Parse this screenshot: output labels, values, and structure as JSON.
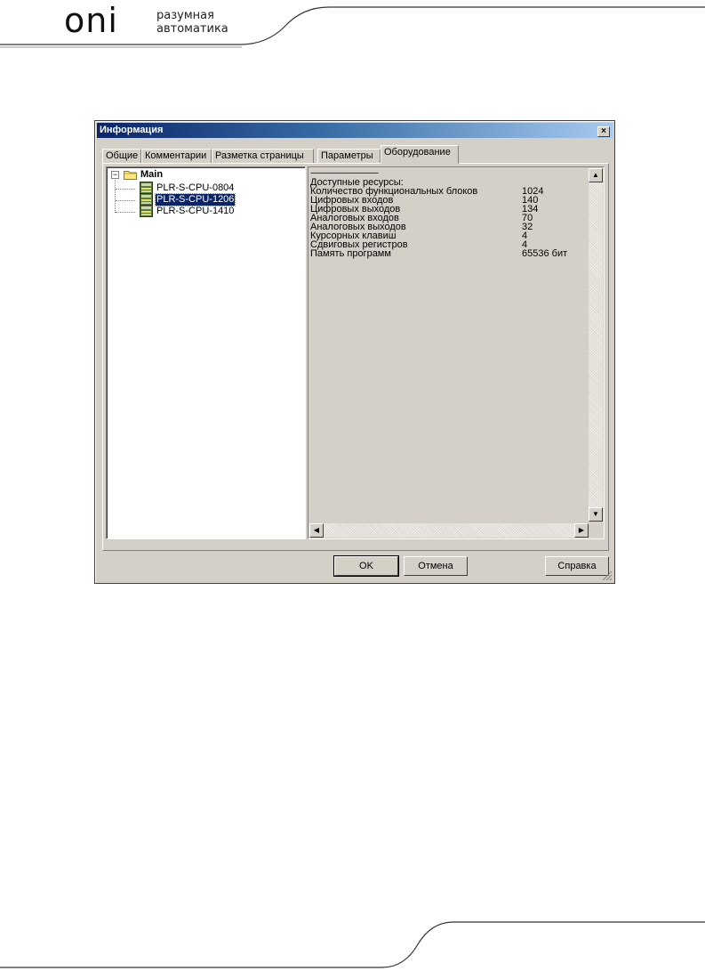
{
  "brand": {
    "logo": "oni",
    "tagline_line1": "разумная",
    "tagline_line2": "автоматика"
  },
  "dialog": {
    "title": "Информация",
    "close_glyph": "×",
    "tabs": [
      {
        "label": "Общие",
        "active": false
      },
      {
        "label": "Комментарии",
        "active": false
      },
      {
        "label": "Разметка страницы",
        "active": false
      },
      {
        "label": "Параметры",
        "active": false
      },
      {
        "label": "Оборудование",
        "active": true
      }
    ],
    "tree": {
      "root": {
        "label": "Main",
        "expander": "−",
        "icon": "folder-icon"
      },
      "children": [
        {
          "label": "PLR-S-CPU-0804",
          "selected": false,
          "icon": "cpu-module-icon"
        },
        {
          "label": "PLR-S-CPU-1206",
          "selected": true,
          "icon": "cpu-module-icon"
        },
        {
          "label": "PLR-S-CPU-1410",
          "selected": false,
          "icon": "cpu-module-icon"
        }
      ]
    },
    "info": {
      "separator": "--------------------------------------",
      "heading": "Доступные ресурсы:",
      "rows": [
        {
          "key": "Количество функциональных блоков",
          "value": "1024"
        },
        {
          "key": "Цифровых входов",
          "value": "140"
        },
        {
          "key": "Цифровых выходов",
          "value": "134"
        },
        {
          "key": "Аналоговых входов",
          "value": "70"
        },
        {
          "key": "Аналоговых выходов",
          "value": "32"
        },
        {
          "key": "Курсорных клавиш",
          "value": "4"
        },
        {
          "key": "Сдвиговых регистров",
          "value": "4"
        },
        {
          "key": "Память программ",
          "value": "65536 бит"
        }
      ]
    },
    "scroll_glyphs": {
      "up": "▲",
      "down": "▼",
      "left": "◀",
      "right": "▶"
    },
    "buttons": {
      "ok": "OK",
      "cancel": "Отмена",
      "help": "Справка"
    }
  },
  "colors": {
    "titlebar_start": "#0a246a",
    "titlebar_end": "#a6caf0",
    "face": "#d4d0c8",
    "selection": "#0a246a"
  }
}
